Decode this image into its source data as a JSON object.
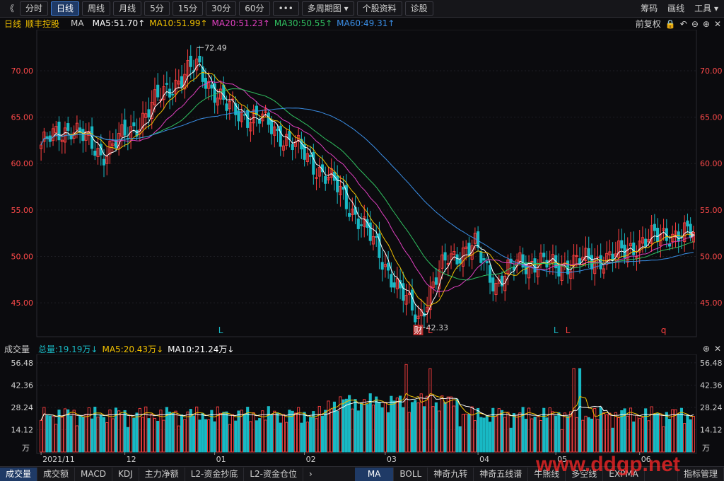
{
  "toolbar": {
    "back": "《",
    "periods": [
      "分时",
      "日线",
      "周线",
      "月线",
      "5分",
      "15分",
      "30分",
      "60分"
    ],
    "active_period": "日线",
    "more": "•••",
    "multi": "多周期图 ▾",
    "profile": "个股资料",
    "diagnose": "诊股",
    "right": [
      "筹码",
      "画线",
      "工具 ▾"
    ]
  },
  "ma_bar": {
    "period": "日线",
    "stock": "顺丰控股",
    "ma": "MA",
    "ma5": "MA5:51.70↑",
    "ma10": "MA10:51.99↑",
    "ma20": "MA20:51.23↑",
    "ma30": "MA30:50.55↑",
    "ma60": "MA60:49.31↑",
    "adjust": "前复权"
  },
  "vol_bar": {
    "title": "成交量",
    "total": "总量:19.19万↓",
    "ma5": "MA5:20.43万↓",
    "ma10": "MA10:21.24万↓"
  },
  "bottom_tabs_left": [
    "成交量",
    "成交额",
    "MACD",
    "KDJ",
    "主力净额",
    "L2-资金抄底",
    "L2-资金仓位"
  ],
  "bottom_tabs_right": [
    "MA",
    "BOLL",
    "神奇九转",
    "神奇五线谱",
    "牛熊线",
    "多空线",
    "EXPMA"
  ],
  "bottom_right": "指标管理",
  "watermark": "www.ddgp.net",
  "colors": {
    "up": "#ff4040",
    "down": "#19b9c4",
    "ma5": "#ffffff",
    "ma10": "#f0c000",
    "ma20": "#e040c0",
    "ma30": "#30c060",
    "ma60": "#3a8ee6",
    "axis": "#ff4a4a"
  },
  "chart_data": [
    {
      "type": "candlestick",
      "title": "",
      "yticks": [
        70.0,
        65.0,
        60.0,
        55.0,
        50.0,
        45.0
      ],
      "ylim": [
        41.5,
        73.5
      ],
      "x_labels": [
        "2021/11",
        "12",
        "01",
        "02",
        "03",
        "04",
        "05",
        "06"
      ],
      "max_label": "72.49",
      "min_label": "42.33",
      "markers": [
        "L",
        "财",
        "L",
        "L",
        "L",
        "q"
      ],
      "key_points": [
        {
          "label": "start",
          "close": 62.0
        },
        {
          "label": "high",
          "value": 72.49
        },
        {
          "label": "low",
          "value": 42.33
        },
        {
          "label": "last",
          "close": 52.3
        }
      ]
    },
    {
      "type": "bar",
      "title": "",
      "unit": "万",
      "yticks": [
        56.48,
        42.36,
        28.24,
        14.12
      ],
      "ylim": [
        0,
        60
      ]
    }
  ]
}
